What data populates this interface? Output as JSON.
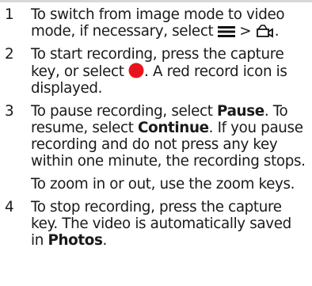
{
  "steps": [
    {
      "number": "1",
      "text_before": "To switch from image mode to video mode, if necessary, select",
      "separator": ">",
      "text_after": ".",
      "icons": [
        "menu-icon",
        "video-camera-icon"
      ]
    },
    {
      "number": "2",
      "text_before": "To start recording, press the capture key, or select",
      "text_after": ". A red record icon is displayed.",
      "icons": [
        "record-icon"
      ],
      "record_color": "#e8141b"
    },
    {
      "number": "3",
      "text_1": "To pause recording, select",
      "bold_1": "Pause",
      "text_2": ". To resume, select",
      "bold_2": "Continue",
      "text_3": ". If you pause recording and do not press any key within one minute, the recording stops.",
      "note": "To zoom in or out, use the zoom keys."
    },
    {
      "number": "4",
      "text_before": "To stop recording, press the capture key. The video is automatically saved in",
      "bold": "Photos",
      "text_after": "."
    }
  ]
}
